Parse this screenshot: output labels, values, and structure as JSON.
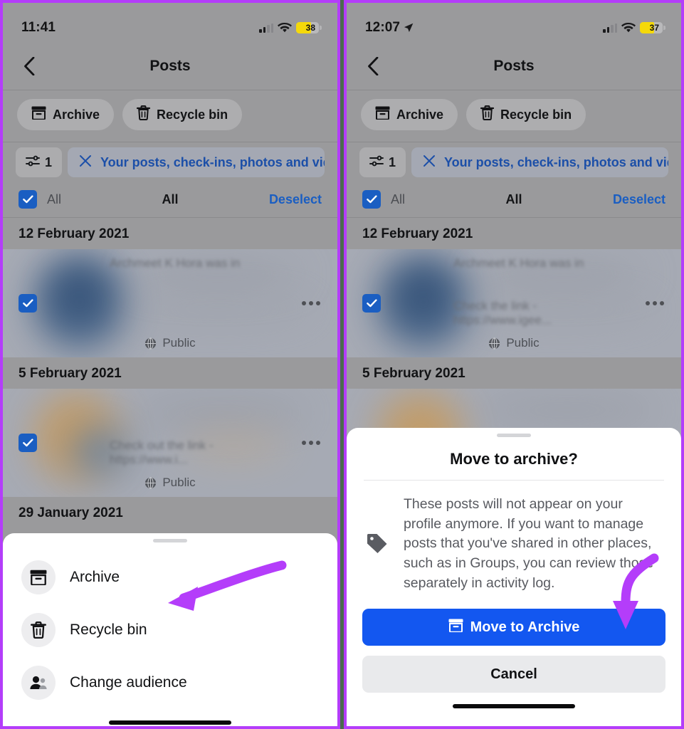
{
  "accent": {
    "purple_annotation": "#b43dfa",
    "facebook_blue": "#1357f0",
    "checkbox_blue": "#1a5ec2",
    "battery_yellow": "#f5d90a"
  },
  "panels": [
    {
      "id": "left",
      "status": {
        "time": "11:41",
        "battery": "38",
        "location_icon": false
      },
      "nav": {
        "back_icon": "chevron-left-icon",
        "title": "Posts"
      },
      "chips": [
        {
          "label": "Archive",
          "icon": "archive-box-icon"
        },
        {
          "label": "Recycle bin",
          "icon": "trash-icon"
        }
      ],
      "filter": {
        "count": "1",
        "count_icon": "sliders-icon",
        "clear_icon": "close-icon",
        "label": "Your posts, check-ins, photos and videos"
      },
      "select": {
        "all_label": "All",
        "middle_label": "All",
        "action_label": "Deselect",
        "checked": true
      },
      "posts": [
        {
          "date": "12 February 2021",
          "author": "Archmeet K Hora was in",
          "snippet": "",
          "privacy": "Public",
          "checked": true,
          "more_icon": "more-horizontal-icon"
        },
        {
          "date": "5 February 2021",
          "author": "",
          "snippet": "Check out the link - https://www.i...",
          "privacy": "Public",
          "checked": true,
          "more_icon": "more-horizontal-icon"
        },
        {
          "date": "29 January 2021",
          "author": "",
          "snippet": "",
          "privacy": "",
          "checked": false,
          "more_icon": "more-horizontal-icon"
        }
      ],
      "sheet": {
        "items": [
          {
            "label": "Archive",
            "icon": "archive-box-icon"
          },
          {
            "label": "Recycle bin",
            "icon": "trash-icon"
          },
          {
            "label": "Change audience",
            "icon": "people-icon"
          }
        ]
      }
    },
    {
      "id": "right",
      "status": {
        "time": "12:07",
        "battery": "37",
        "location_icon": true
      },
      "nav": {
        "back_icon": "chevron-left-icon",
        "title": "Posts"
      },
      "chips": [
        {
          "label": "Archive",
          "icon": "archive-box-icon"
        },
        {
          "label": "Recycle bin",
          "icon": "trash-icon"
        }
      ],
      "filter": {
        "count": "1",
        "count_icon": "sliders-icon",
        "clear_icon": "close-icon",
        "label": "Your posts, check-ins, photos and videos"
      },
      "select": {
        "all_label": "All",
        "middle_label": "All",
        "action_label": "Deselect",
        "checked": true
      },
      "posts": [
        {
          "date": "12 February 2021",
          "author": "Archmeet K Hora was in",
          "snippet": "Check the link - https://www.igee...",
          "privacy": "Public",
          "checked": true,
          "more_icon": "more-horizontal-icon"
        },
        {
          "date": "5 February 2021",
          "author": "",
          "snippet": "",
          "privacy": "",
          "checked": false,
          "more_icon": "more-horizontal-icon"
        }
      ],
      "dialog": {
        "title": "Move to archive?",
        "icon": "tag-icon",
        "body": "These posts will not appear on your profile anymore. If you want to manage posts that you've shared in other places, such as in Groups, you can review those separately in activity log.",
        "primary_button": {
          "label": "Move to Archive",
          "icon": "archive-box-icon"
        },
        "secondary_button": {
          "label": "Cancel"
        }
      }
    }
  ]
}
